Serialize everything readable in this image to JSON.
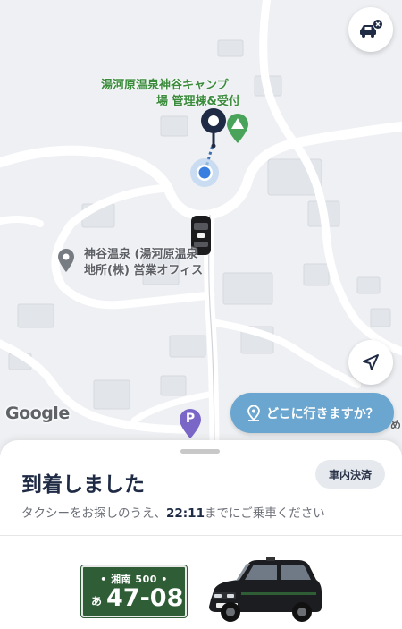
{
  "map": {
    "poi_campsite": {
      "line1": "湯河原温泉神谷キャンプ",
      "line2": "場 管理棟&受付",
      "icon": "campsite-triangle-icon"
    },
    "poi_onsen": {
      "line1": "神谷温泉 (湯河原温泉",
      "line2": "地所(株) 営業オフィス",
      "icon": "place-pin-icon"
    },
    "google_logo": "Google",
    "parking_label": "P",
    "edge_label": "め"
  },
  "buttons": {
    "where_to": "どこに行きますか？",
    "cancel_taxi_icon": "taxi-cancel-icon",
    "my_location_icon": "navigation-arrow-icon"
  },
  "sheet": {
    "title": "到着しました",
    "payment_badge": "車内決済",
    "subtitle_before": "タクシーをお探しのうえ、",
    "subtitle_time": "22:11",
    "subtitle_after": "までにご乗車ください"
  },
  "plate": {
    "region": "• 湘南 500 •",
    "kana": "あ",
    "number": "47-08"
  },
  "colors": {
    "brand_navy": "#1f2b45",
    "where_button": "#6aa6cf",
    "plate_green": "#2f5e36",
    "poi_green": "#3b8b3d"
  }
}
